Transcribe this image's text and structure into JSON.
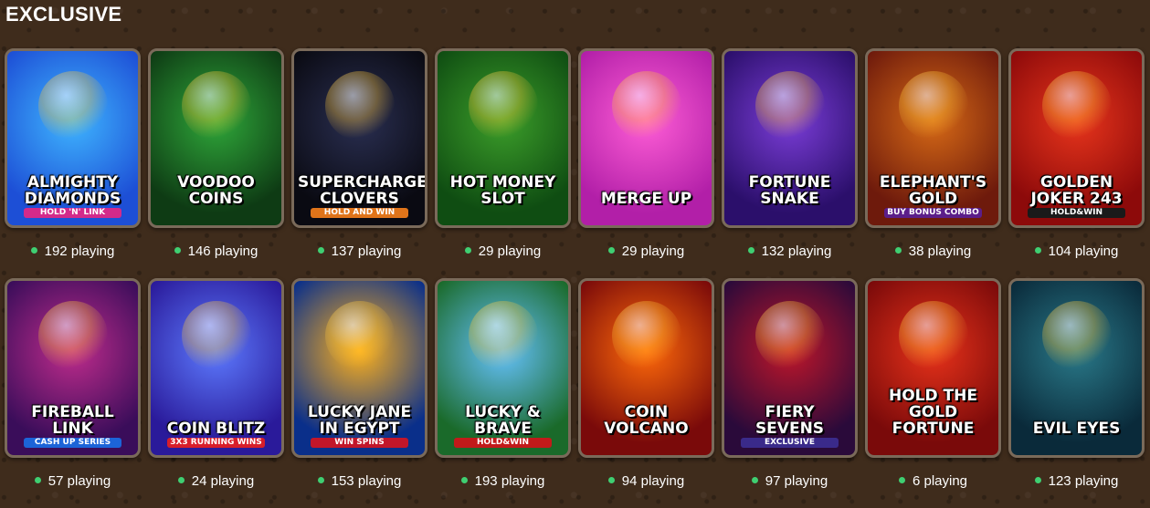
{
  "section": {
    "title": "EXCLUSIVE"
  },
  "games": [
    {
      "title": "ALMIGHTY DIAMONDS",
      "subtitle": "HOLD 'N' LINK",
      "players": "192 playing",
      "bg": [
        "#1d4fd6",
        "#3fb6ff"
      ],
      "subbg": "#d42a8a",
      "icon": "diamond-icon"
    },
    {
      "title": "VOODOO COINS",
      "subtitle": "",
      "players": "146 playing",
      "bg": [
        "#0e3b14",
        "#2fa83a"
      ],
      "subbg": "",
      "icon": "skull-icon"
    },
    {
      "title": "SUPERCHARGED CLOVERS",
      "subtitle": "HOLD AND WIN",
      "players": "137 playing",
      "bg": [
        "#0a0a12",
        "#2a2f52"
      ],
      "subbg": "#e0741a",
      "icon": "clover-icon"
    },
    {
      "title": "HOT MONEY Slot",
      "subtitle": "",
      "players": "29 playing",
      "bg": [
        "#0f4d12",
        "#3c9e2a"
      ],
      "subbg": "",
      "icon": "money-icon"
    },
    {
      "title": "MERGE UP",
      "subtitle": "",
      "players": "29 playing",
      "bg": [
        "#b21fa8",
        "#ff5ed6"
      ],
      "subbg": "",
      "icon": "heart-icon"
    },
    {
      "title": "Fortune SNAKE",
      "subtitle": "",
      "players": "132 playing",
      "bg": [
        "#2b0f6b",
        "#7b3dd8"
      ],
      "subbg": "",
      "icon": "snake-icon"
    },
    {
      "title": "ELEPHANT'S GOLD",
      "subtitle": "BUY BONUS COMBO",
      "players": "38 playing",
      "bg": [
        "#6e1a0c",
        "#d76a16"
      ],
      "subbg": "#5b1e8a",
      "icon": "elephant-icon"
    },
    {
      "title": "GOLDEN JOKER 243",
      "subtitle": "HOLD&WIN",
      "players": "104 playing",
      "bg": [
        "#8d0a0a",
        "#e8351c"
      ],
      "subbg": "#1a1a1a",
      "icon": "seven-icon"
    },
    {
      "title": "FIREBALL LINK",
      "subtitle": "CASH UP SERIES",
      "players": "57 playing",
      "bg": [
        "#3a0d5a",
        "#c02c8c"
      ],
      "subbg": "#1c64d8",
      "icon": "fireball-icon"
    },
    {
      "title": "COIN BLITZ",
      "subtitle": "3X3 RUNNING WINS",
      "players": "24 playing",
      "bg": [
        "#2a1a9a",
        "#5d7bff"
      ],
      "subbg": "#d81e2a",
      "icon": "lightning-icon"
    },
    {
      "title": "LUCKY JANE IN EGYPT",
      "subtitle": "WIN SPINS",
      "players": "153 playing",
      "bg": [
        "#0a2f8a",
        "#ffb21c"
      ],
      "subbg": "#c2162a",
      "icon": "hat-icon"
    },
    {
      "title": "LUCKY & BRAVE",
      "subtitle": "HOLD&WIN",
      "players": "193 playing",
      "bg": [
        "#1a6a2a",
        "#66c2ff"
      ],
      "subbg": "#c21a1a",
      "icon": "viking-icon"
    },
    {
      "title": "COIN VOLCANO",
      "subtitle": "",
      "players": "94 playing",
      "bg": [
        "#7a0a0a",
        "#ff6a0a"
      ],
      "subbg": "",
      "icon": "volcano-icon"
    },
    {
      "title": "FIERY SEVENS",
      "subtitle": "EXCLUSIVE",
      "players": "97 playing",
      "bg": [
        "#2a0a3a",
        "#c0162a"
      ],
      "subbg": "#3a2a8a",
      "icon": "seven-icon"
    },
    {
      "title": "HOLD THE GOLD FORTUNE",
      "subtitle": "",
      "players": "6 playing",
      "bg": [
        "#7a0a0a",
        "#e8321a"
      ],
      "subbg": "",
      "icon": "coin-icon"
    },
    {
      "title": "EVIL EYES",
      "subtitle": "",
      "players": "123 playing",
      "bg": [
        "#0a2a3a",
        "#2a7a8a"
      ],
      "subbg": "",
      "icon": "eye-icon"
    }
  ]
}
